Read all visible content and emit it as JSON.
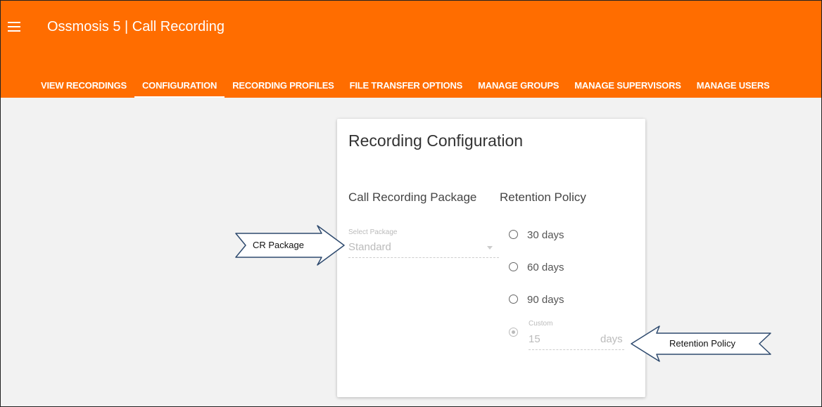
{
  "app": {
    "title": "Ossmosis 5 | Call Recording"
  },
  "tabs": [
    {
      "label": "VIEW RECORDINGS"
    },
    {
      "label": "CONFIGURATION"
    },
    {
      "label": "RECORDING PROFILES"
    },
    {
      "label": "FILE TRANSFER OPTIONS"
    },
    {
      "label": "MANAGE GROUPS"
    },
    {
      "label": "MANAGE SUPERVISORS"
    },
    {
      "label": "MANAGE USERS"
    }
  ],
  "card": {
    "title": "Recording Configuration",
    "package_heading": "Call Recording Package",
    "retention_heading": "Retention Policy",
    "select_label": "Select Package",
    "select_value": "Standard",
    "retention_options": [
      {
        "label": "30 days"
      },
      {
        "label": "60 days"
      },
      {
        "label": "90 days"
      }
    ],
    "custom_label": "Custom",
    "custom_value": "15",
    "custom_unit": "days"
  },
  "callouts": {
    "package": "CR Package",
    "retention": "Retention Policy"
  },
  "colors": {
    "accent": "#ff6d00",
    "background": "#f2f2f2"
  }
}
